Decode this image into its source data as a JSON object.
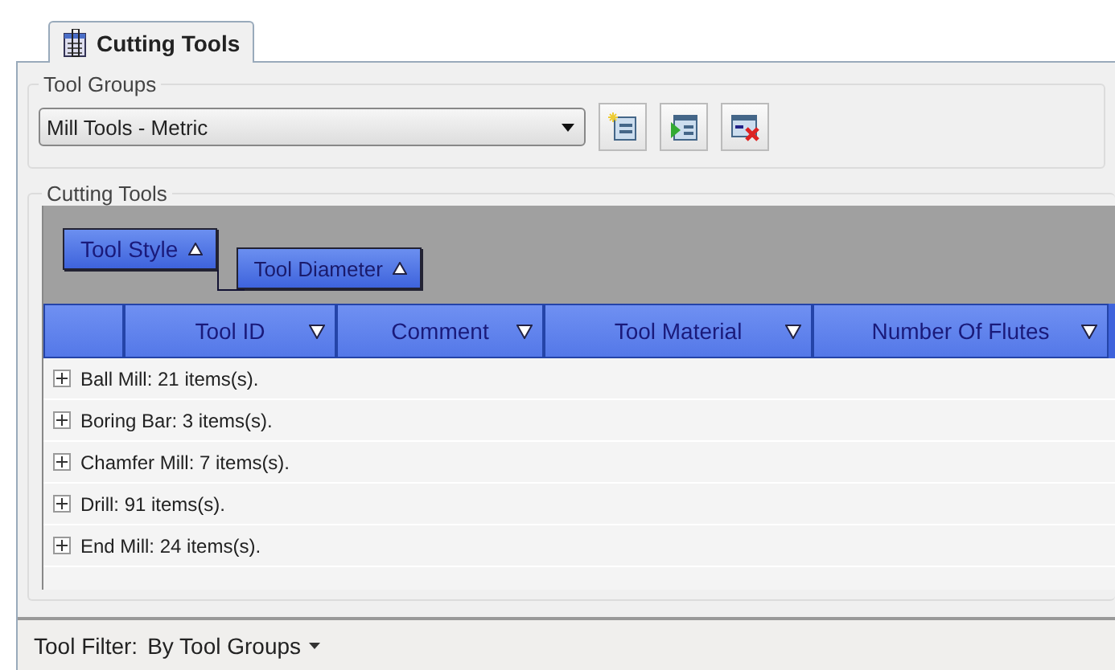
{
  "tab": {
    "label": "Cutting Tools",
    "selected": true
  },
  "tool_groups": {
    "title": "Tool Groups",
    "combo_value": "Mill Tools - Metric"
  },
  "cutting_tools": {
    "title": "Cutting Tools",
    "group_by": [
      {
        "label": "Tool Style",
        "sort_ascending": true
      },
      {
        "label": "Tool Diameter",
        "sort_ascending": true
      }
    ],
    "columns": [
      "Tool ID",
      "Comment",
      "Tool Material",
      "Number Of Flutes"
    ],
    "rows": [
      {
        "label": "Ball Mill: 21 items(s).",
        "expanded": false
      },
      {
        "label": "Boring Bar: 3 items(s).",
        "expanded": false
      },
      {
        "label": "Chamfer Mill: 7 items(s).",
        "expanded": false
      },
      {
        "label": "Drill: 91 items(s).",
        "expanded": false
      },
      {
        "label": "End Mill: 24 items(s).",
        "expanded": false
      }
    ]
  },
  "status_bar": {
    "label": "Tool Filter:",
    "value": "By Tool Groups"
  }
}
